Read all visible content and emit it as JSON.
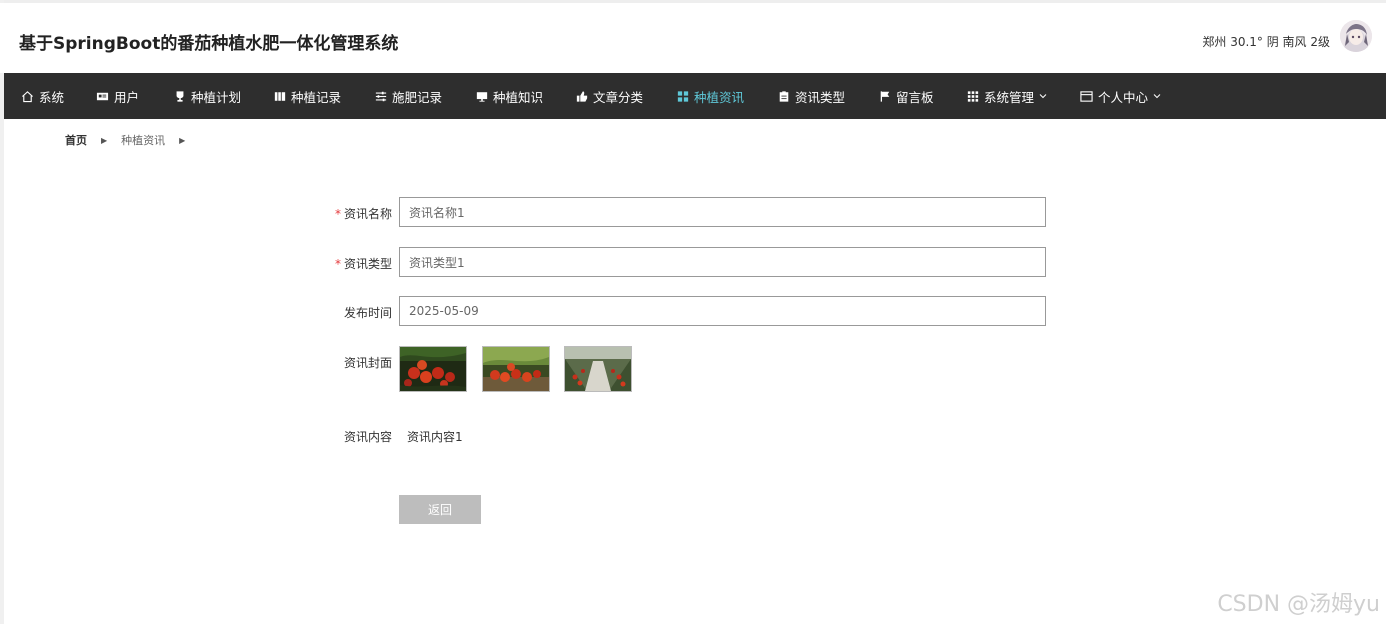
{
  "header": {
    "title": "基于SpringBoot的番茄种植水肥一体化管理系统",
    "weather": "郑州  30.1°  阴  南风  2级"
  },
  "nav": {
    "items": [
      {
        "label": "系统",
        "icon": "home-icon"
      },
      {
        "label": "用户",
        "icon": "user-card-icon"
      },
      {
        "label": "种植计划",
        "icon": "trophy-icon"
      },
      {
        "label": "种植记录",
        "icon": "book-icon"
      },
      {
        "label": "施肥记录",
        "icon": "sliders-icon"
      },
      {
        "label": "种植知识",
        "icon": "monitor-icon"
      },
      {
        "label": "文章分类",
        "icon": "thumb-up-icon"
      },
      {
        "label": "种植资讯",
        "icon": "grid-icon"
      },
      {
        "label": "资讯类型",
        "icon": "clipboard-icon"
      },
      {
        "label": "留言板",
        "icon": "flag-icon"
      },
      {
        "label": "系统管理",
        "icon": "apps-grid-icon"
      },
      {
        "label": "个人中心",
        "icon": "window-icon"
      }
    ],
    "active_index": 7,
    "active_color": "#5fc8d8"
  },
  "breadcrumb": {
    "home": "首页",
    "current": "种植资讯"
  },
  "form": {
    "name_label": "资讯名称",
    "name_value": "资讯名称1",
    "type_label": "资讯类型",
    "type_value": "资讯类型1",
    "time_label": "发布时间",
    "time_value": "2025-05-09",
    "cover_label": "资讯封面",
    "content_label": "资讯内容",
    "content_value": "资讯内容1",
    "required_mark": "*",
    "back_label": "返回"
  },
  "watermark": "CSDN @汤姆yu"
}
